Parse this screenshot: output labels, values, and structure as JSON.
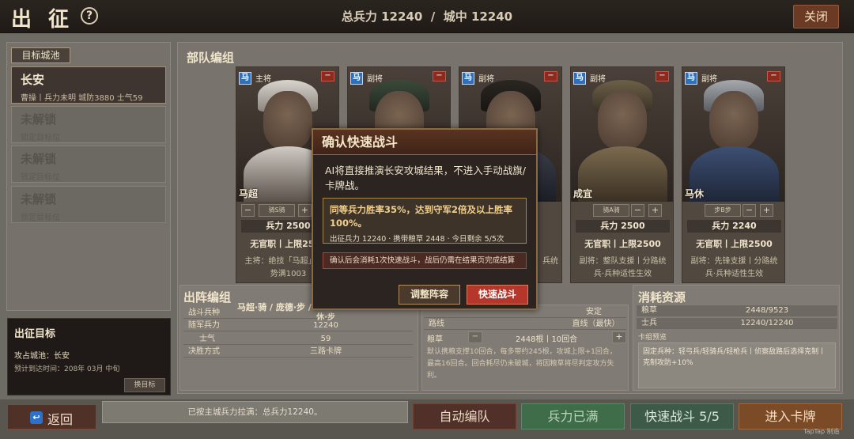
{
  "header": {
    "title": "出 征",
    "help_label": "?",
    "total_troops_label": "总兵力",
    "total_troops": "12240",
    "separator": "/",
    "city_troops_label": "城中",
    "city_troops": "12240",
    "close_label": "关闭"
  },
  "target_cities": {
    "tag": "目标城池",
    "items": [
      {
        "name": "长安",
        "sub": "曹操丨兵力未明 城防3880 士气59"
      },
      {
        "name": "未解锁",
        "sub": "锁定目标位"
      },
      {
        "name": "未解锁",
        "sub": "锁定目标位"
      },
      {
        "name": "未解锁",
        "sub": "锁定目标位"
      }
    ]
  },
  "goal": {
    "title": "出征目标",
    "line1": "攻占城池：长安",
    "line2": "预计到达时间：208年 03月 中旬",
    "change_label": "换目标"
  },
  "army_section_title": "部队编组",
  "generals": [
    {
      "badge": "马",
      "role": "主将",
      "name": "马超",
      "troop_select": "骑S骑",
      "troops": "兵力 2500",
      "cap": "无官职丨上限2500",
      "desc": "主将：绝技「马超」丨冒势满1003",
      "minus": "−",
      "plus": "+",
      "remove": "−"
    },
    {
      "badge": "马",
      "role": "副将",
      "name": "",
      "troop_select": "",
      "troops": "",
      "cap": "",
      "desc": "",
      "minus": "−",
      "plus": "+",
      "remove": "−"
    },
    {
      "badge": "马",
      "role": "副将",
      "name": "",
      "troop_select": "",
      "troops": "",
      "cap": "",
      "desc": "兵统",
      "minus": "−",
      "plus": "+",
      "remove": "−"
    },
    {
      "badge": "马",
      "role": "副将",
      "name": "成宜",
      "troop_select": "骑A骑",
      "troops": "兵力 2500",
      "cap": "无官职丨上限2500",
      "desc": "副将：整队支援丨分路统兵·兵种适性生效",
      "minus": "−",
      "plus": "+",
      "remove": "−"
    },
    {
      "badge": "马",
      "role": "副将",
      "name": "马休",
      "troop_select": "步B步",
      "troops": "兵力 2240",
      "cap": "无官职丨上限2500",
      "desc": "副将：先锋支援丨分路统兵·兵种适性生效",
      "minus": "−",
      "plus": "+",
      "remove": "−"
    }
  ],
  "deployment": {
    "title": "出阵编组",
    "generals_line": "马超·骑 / 庞德·步 / …",
    "rows": [
      {
        "label": "战斗兵种",
        "value": "休·步"
      },
      {
        "label": "随军兵力",
        "value": "12240"
      },
      {
        "label": "士气",
        "value": "59"
      },
      {
        "label": "决胜方式",
        "value": "三路卡牌"
      }
    ]
  },
  "march": {
    "rows": [
      {
        "label": "",
        "value": "安定"
      },
      {
        "label": "路线",
        "value": "直线（最快）"
      }
    ],
    "grain_label": "粮草",
    "grain_minus": "−",
    "grain_value": "2448根丨10回合",
    "grain_plus": "+",
    "note": "默认携粮支撑10回合，每多带约245根，攻城上限+1回合，最高16回合。回合耗尽仍未破城，将因粮草将尽判定攻方失利。"
  },
  "resources": {
    "title": "消耗资源",
    "rows": [
      {
        "label": "粮草",
        "value": "2448/9523"
      },
      {
        "label": "士兵",
        "value": "12240/12240"
      }
    ],
    "preview_label": "卡组预览",
    "preview_text": "固定兵种：轻弓兵/轻骑兵/轻枪兵丨侦察敌路后选择克制丨克制攻防+10%"
  },
  "modal": {
    "title": "确认快速战斗",
    "text": "AI将直接推演长安攻城结果，不进入手动战旗/卡牌战。",
    "highlight": "同等兵力胜率35%，达到守军2倍及以上胜率100%。",
    "stats": "出征兵力 12240 · 携带粮草 2448 · 今日剩余 5/5次",
    "warning": "确认后会消耗1次快速战斗，战后仍需在结果页完成结算",
    "adjust_label": "调整阵容",
    "confirm_label": "快速战斗"
  },
  "footer": {
    "back_icon": "↩",
    "back_label": "返回",
    "notice": "已按主城兵力拉满：总兵力12240。",
    "auto_label": "自动编队",
    "full_label": "兵力已满",
    "quick_label": "快速战斗 5/5",
    "card_label": "进入卡牌",
    "watermark": "TapTap 制造"
  },
  "colors": {
    "confirm": "#b5362b",
    "full_button": "#3f6c49",
    "auto_button": "#503028",
    "card_button": "#7b4a26"
  }
}
